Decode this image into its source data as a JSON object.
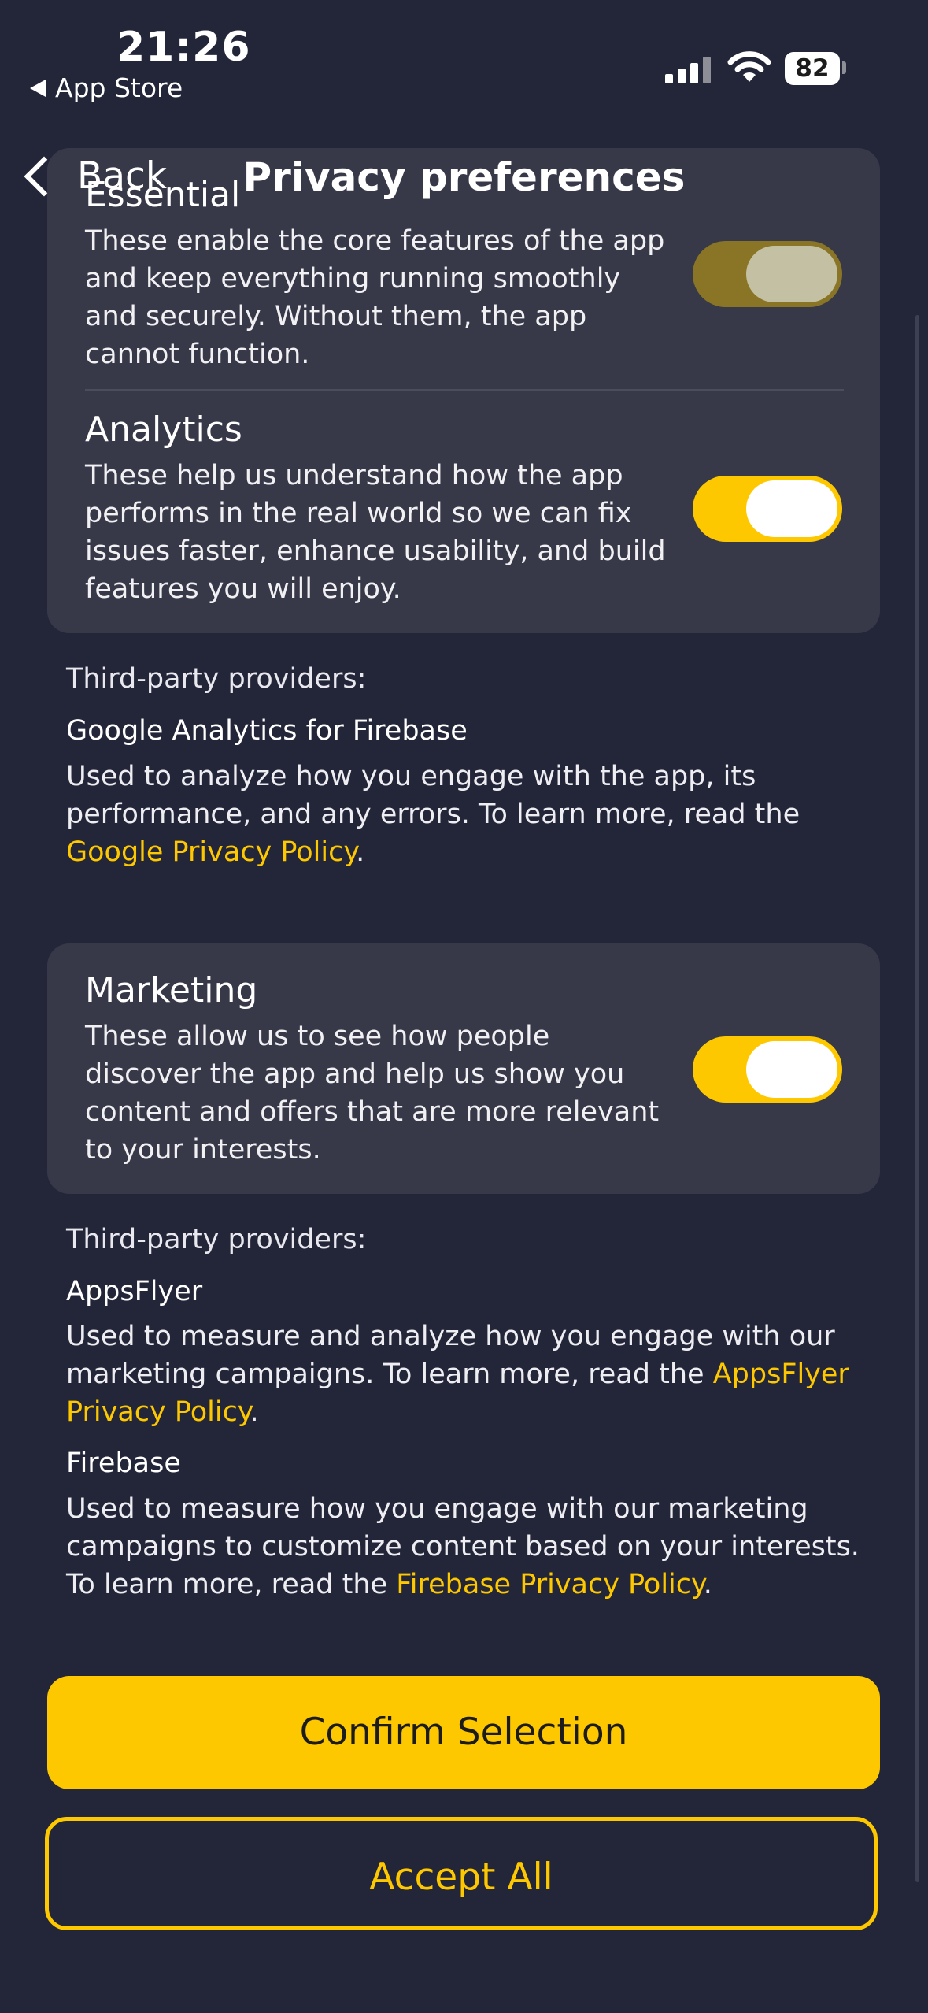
{
  "status_bar": {
    "time": "21:26",
    "back_app": "App Store",
    "battery": "82"
  },
  "nav": {
    "back_label": "Back",
    "title": "Privacy preferences"
  },
  "categories": [
    {
      "title": "Essential",
      "description": "These enable the core features of the app and keep everything running smoothly and securely. Without them, the app cannot function.",
      "toggle_on": true,
      "toggle_disabled": true
    },
    {
      "title": "Analytics",
      "description": "These help us understand how the app performs in the real world so we can fix issues faster, enhance usability, and build features you will enjoy.",
      "toggle_on": true,
      "toggle_disabled": false
    },
    {
      "title": "Marketing",
      "description": "These allow us to see how people discover the app and help us show you content and offers that are more relevant to your interests.",
      "toggle_on": true,
      "toggle_disabled": false
    }
  ],
  "analytics_providers": {
    "heading": "Third-party providers:",
    "items": [
      {
        "name": "Google Analytics for Firebase",
        "desc_before": "Used to analyze how you engage with the app, its performance, and any errors. To learn more, read the ",
        "link": "Google Privacy Policy",
        "desc_after": "."
      }
    ]
  },
  "marketing_providers": {
    "heading": "Third-party providers:",
    "items": [
      {
        "name": "AppsFlyer",
        "desc_before": "Used to measure and analyze how you engage with our marketing campaigns. To learn more, read the ",
        "link": "AppsFlyer Privacy Policy",
        "desc_after": "."
      },
      {
        "name": "Firebase",
        "desc_before": "Used to measure how you engage with our marketing campaigns to customize content based on your interests. To learn more, read the ",
        "link": "Firebase Privacy Policy",
        "desc_after": "."
      }
    ]
  },
  "buttons": {
    "confirm": "Confirm Selection",
    "accept_all": "Accept All"
  },
  "colors": {
    "background": "#232539",
    "card": "#373848",
    "accent": "#fec800"
  }
}
